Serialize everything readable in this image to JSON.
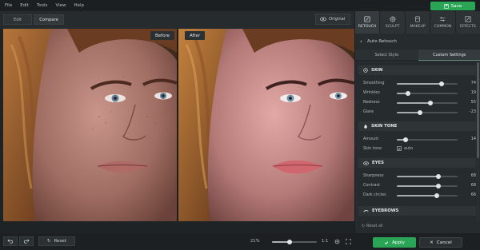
{
  "menu": [
    "File",
    "Edit",
    "Tools",
    "View",
    "Help"
  ],
  "save_label": "Save",
  "view_tabs": {
    "edit": "Edit",
    "compare": "Compare"
  },
  "original_label": "Original",
  "compare": {
    "before_label": "Before",
    "after_label": "After"
  },
  "tool_tabs": [
    "RETOUCH",
    "SCULPT",
    "MAKEUP",
    "COMMON",
    "EFFECTS"
  ],
  "panel": {
    "back_title": "Auto Retouch",
    "sub_tabs": [
      "Select Style",
      "Custom Settings"
    ],
    "sections": {
      "skin": {
        "title": "SKIN",
        "rows": [
          {
            "label": "Smoothing",
            "value": "74",
            "level": 0.74
          },
          {
            "label": "Wrinkles",
            "value": "19",
            "level": 0.19
          },
          {
            "label": "Redness",
            "value": "55",
            "level": 0.55
          },
          {
            "label": "Glare",
            "value": "-23",
            "level": 0.38
          }
        ]
      },
      "skin_tone": {
        "title": "SKIN TONE",
        "amount": {
          "label": "Amount",
          "value": "14",
          "level": 0.14
        },
        "skin_tone_label": "Skin tone",
        "auto_label": "auto",
        "auto_checked": true
      },
      "eyes": {
        "title": "EYES",
        "rows": [
          {
            "label": "Sharpness",
            "value": "68",
            "level": 0.68
          },
          {
            "label": "Contrast",
            "value": "68",
            "level": 0.68
          },
          {
            "label": "Dark circles",
            "value": "66",
            "level": 0.66
          }
        ]
      },
      "eyebrows": {
        "title": "EYEBROWS"
      }
    },
    "reset_all_label": "Reset all"
  },
  "bottom": {
    "reset_label": "Reset",
    "zoom_text": "21%",
    "zoom_level": 0.4,
    "ratio_label": "1:1"
  },
  "actions": {
    "apply": "Apply",
    "cancel": "Cancel"
  },
  "colors": {
    "accent": "#2aa556",
    "panel_bg": "#262b2d",
    "app_bg": "#1e2325"
  }
}
